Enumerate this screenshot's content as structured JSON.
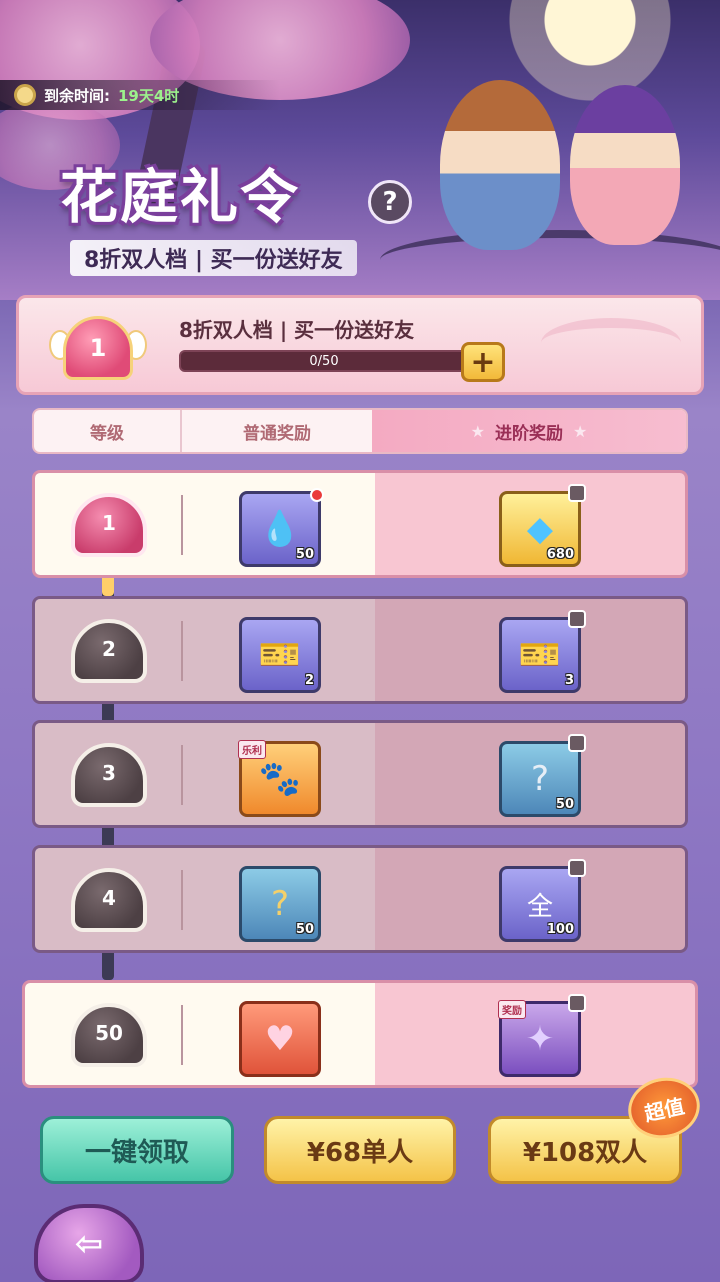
{
  "header": {
    "timer_label": "到余时间:",
    "timer_value": "19天4时",
    "title": "花庭礼令",
    "help": "?",
    "subtitle": "8折双人档 | 买一份送好友"
  },
  "progress": {
    "level": "1",
    "title": "8折双人档 | 买一份送好友",
    "bar_text": "0/50",
    "fraction": 0,
    "plus": "+"
  },
  "columns": {
    "level": "等级",
    "normal": "普通奖励",
    "advanced": "进阶奖励"
  },
  "rows": [
    {
      "level": "1",
      "normal": {
        "icon": "water-drop-icon",
        "qty": "50"
      },
      "advanced": {
        "icon": "diamond-icon",
        "qty": "680"
      }
    },
    {
      "level": "2",
      "normal": {
        "icon": "ticket-icon",
        "qty": "2"
      },
      "advanced": {
        "icon": "ticket-icon",
        "qty": "3"
      }
    },
    {
      "level": "3",
      "normal": {
        "icon": "pet-icon",
        "qty": "",
        "tag": "乐利"
      },
      "advanced": {
        "icon": "mystery-scroll-icon",
        "qty": "50"
      }
    },
    {
      "level": "4",
      "normal": {
        "icon": "mystery-orb-icon",
        "qty": "50"
      },
      "advanced": {
        "icon": "all-orb-icon",
        "qty": "100"
      }
    },
    {
      "level": "50",
      "normal": {
        "icon": "heart-ring-icon",
        "qty": ""
      },
      "advanced": {
        "icon": "weapon-icon",
        "qty": "",
        "tag": "奖励"
      }
    }
  ],
  "buttons": {
    "claim_all": "一键领取",
    "single": "¥68单人",
    "double": "¥108双人",
    "badge": "超值"
  }
}
